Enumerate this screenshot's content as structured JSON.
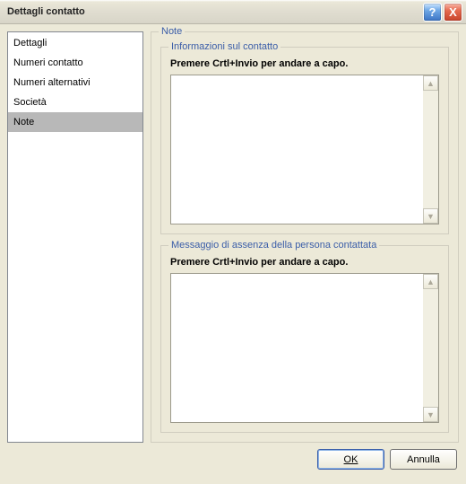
{
  "titlebar": {
    "title": "Dettagli contatto",
    "help_label": "?",
    "close_label": "X"
  },
  "sidebar": {
    "items": [
      {
        "label": "Dettagli",
        "selected": false
      },
      {
        "label": "Numeri contatto",
        "selected": false
      },
      {
        "label": "Numeri alternativi",
        "selected": false
      },
      {
        "label": "Società",
        "selected": false
      },
      {
        "label": "Note",
        "selected": true
      }
    ]
  },
  "main": {
    "outer_legend": "Note",
    "sections": [
      {
        "legend": "Informazioni sul contatto",
        "hint": "Premere Crtl+Invio per andare a capo.",
        "value": ""
      },
      {
        "legend": "Messaggio di assenza della persona contattata",
        "hint": "Premere Crtl+Invio per andare a capo.",
        "value": ""
      }
    ]
  },
  "buttons": {
    "ok": "OK",
    "cancel": "Annulla"
  },
  "scroll": {
    "up": "▲",
    "down": "▼"
  }
}
